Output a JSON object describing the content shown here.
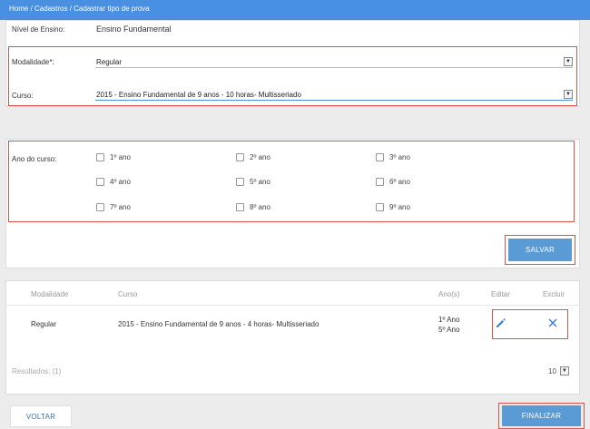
{
  "breadcrumb": {
    "home": "Home",
    "cadastros": "Cadastros",
    "current": "Cadastrar tipo de prova",
    "sep": " / "
  },
  "form": {
    "nivel_label": "Nível de Ensino:",
    "nivel_value": "Ensino Fundamental",
    "modalidade_label": "Modalidade*:",
    "modalidade_value": "Regular",
    "curso_label": "Curso:",
    "curso_value": "2015 - Ensino Fundamental de 9 anos - 10 horas- Multisseriado"
  },
  "anos": {
    "label": "Ano do curso:",
    "items": [
      "1º ano",
      "2º ano",
      "3º ano",
      "4º ano",
      "5º ano",
      "6º ano",
      "7º ano",
      "8º ano",
      "9º ano"
    ]
  },
  "actions": {
    "salvar": "SALVAR",
    "voltar": "VOLTAR",
    "finalizar": "FINALIZAR"
  },
  "table": {
    "headers": {
      "modalidade": "Modalidade",
      "curso": "Curso",
      "anos": "Ano(s)",
      "editar": "Editar",
      "excluir": "Excluir"
    },
    "rows": [
      {
        "modalidade": "Regular",
        "curso": "2015 - Ensino Fundamental de 9 anos - 4 horas- Multisseriado",
        "ano1": "1º Ano",
        "ano2": "5º Ano"
      }
    ],
    "results": "Resultados: (1)",
    "page_size": "10"
  },
  "icons": {
    "dropdown": "chevron-down-icon",
    "edit": "pencil-icon",
    "delete": "close-icon"
  },
  "colors": {
    "topbar": "#4a90e2",
    "primary": "#5b9bd5",
    "highlight": "#d9534f",
    "edit": "#3a7bd5"
  }
}
